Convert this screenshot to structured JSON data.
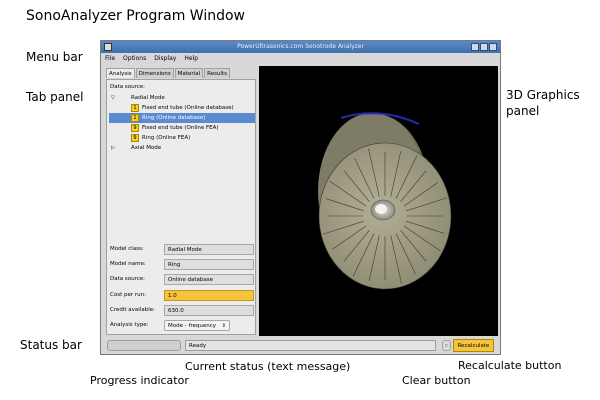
{
  "annotations": {
    "program_window": "SonoAnalyzer Program Window",
    "menu_bar": "Menu bar",
    "tab_panel": "Tab panel",
    "graphics_panel_line1": "3D Graphics",
    "graphics_panel_line2": "panel",
    "status_bar": "Status bar",
    "progress_indicator": "Progress indicator",
    "current_status": "Current status (text message)",
    "clear_button": "Clear button",
    "recalculate_button": "Recalculate button"
  },
  "window": {
    "title": "PowerUltrasonics.com Sonotrode Analyzer"
  },
  "menu": [
    "File",
    "Options",
    "Display",
    "Help"
  ],
  "tabs": [
    "Analysis",
    "Dimensions",
    "Material",
    "Results"
  ],
  "analysis": {
    "data_source_label": "Data source:",
    "tree": [
      {
        "label": "Radial Mode",
        "level": 0,
        "arrow": "▽"
      },
      {
        "label": "Fixed end tube (Online database)",
        "level": 1,
        "badge": "1"
      },
      {
        "label": "Ring (Online database)",
        "level": 1,
        "badge": "1",
        "selected": true
      },
      {
        "label": "Fixed end tube (Online FEA)",
        "level": 1,
        "badge": "9"
      },
      {
        "label": "Ring (Online FEA)",
        "level": 1,
        "badge": "9"
      },
      {
        "label": "Axial Mode",
        "level": 0,
        "arrow": "▷"
      }
    ],
    "fields": {
      "model_class": {
        "label": "Model class:",
        "value": "Radial Mode"
      },
      "model_name": {
        "label": "Model name:",
        "value": "Ring"
      },
      "data_source": {
        "label": "Data source:",
        "value": "Online database"
      },
      "cost_per_run": {
        "label": "Cost per run:",
        "value": "1.0"
      },
      "credit": {
        "label": "Credit available:",
        "value": "630.0"
      },
      "analysis_type": {
        "label": "Analysis type:",
        "value": "Mode - frequency"
      }
    }
  },
  "status": {
    "text": "Ready",
    "clear_symbol": "c",
    "recalculate_label": "Recalculate"
  },
  "colors": {
    "accent_yellow": "#f6c43c",
    "selection_blue": "#5a8ad0",
    "ring_face": "#a29f86"
  }
}
